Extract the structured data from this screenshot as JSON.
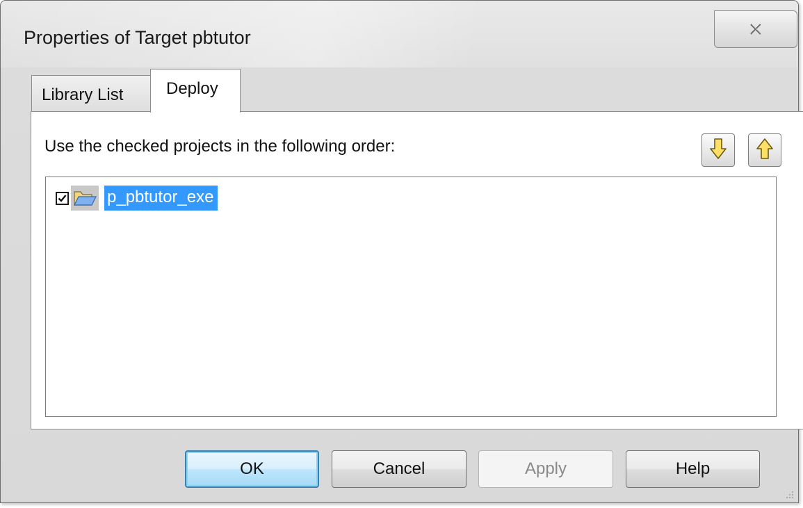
{
  "window": {
    "title": "Properties of Target pbtutor"
  },
  "tabs": [
    {
      "label": "Library List",
      "active": false
    },
    {
      "label": "Deploy",
      "active": true
    }
  ],
  "deploy": {
    "instruction": "Use the checked projects in the following order:",
    "projects": [
      {
        "label": "p_pbtutor_exe",
        "checked": true,
        "selected": true,
        "icon": "open-folder-icon"
      }
    ]
  },
  "buttons": {
    "ok": "OK",
    "cancel": "Cancel",
    "apply": "Apply",
    "help": "Help"
  },
  "icons": {
    "close": "close-icon",
    "move_down": "arrow-down-icon",
    "move_up": "arrow-up-icon"
  },
  "colors": {
    "selection": "#3399ff",
    "arrow_fill": "#ffe066",
    "default_button_border": "#3c7fb1"
  }
}
